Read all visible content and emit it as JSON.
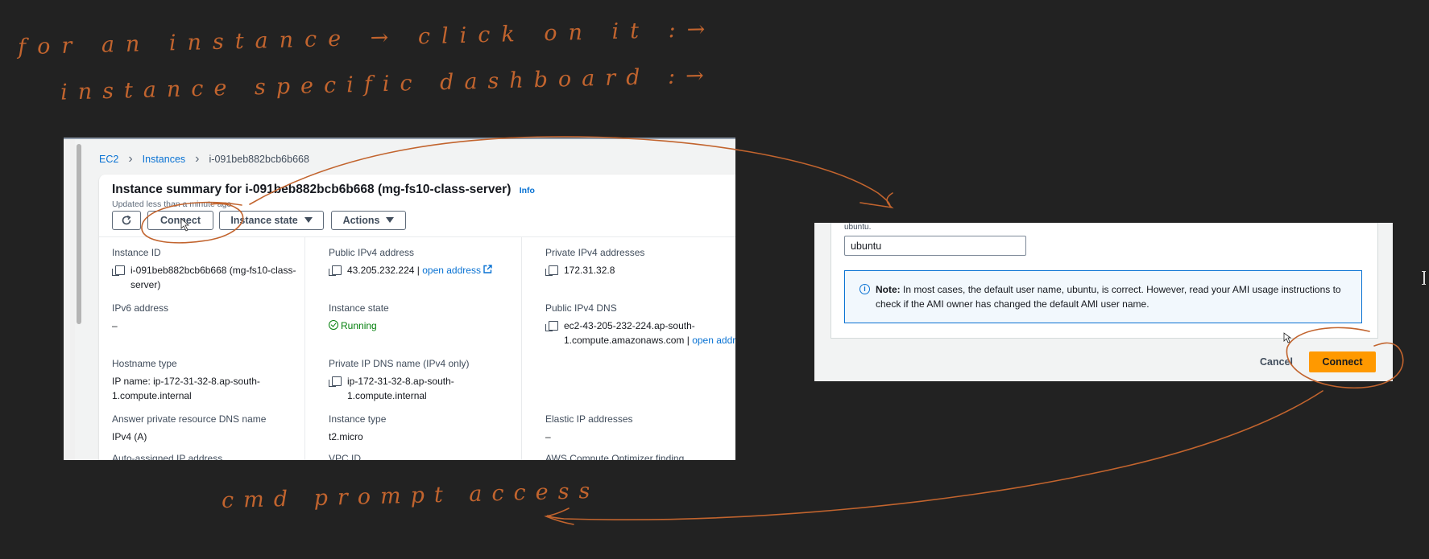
{
  "annotations": {
    "line1": "for an instance → click on it :→",
    "line2": "instance specific dashboard :→",
    "line3": "cmd prompt access"
  },
  "colors": {
    "background": "#222222",
    "ink": "#c2642e",
    "aws_link": "#0972d3",
    "aws_primary_button": "#ff9900",
    "running_green": "#037f0c"
  },
  "breadcrumb": {
    "items": [
      "EC2",
      "Instances",
      "i-091beb882bcb6b668"
    ]
  },
  "summary": {
    "title": "Instance summary for i-091beb882bcb6b668 (mg-fs10-class-server)",
    "info": "Info",
    "updated": "Updated less than a minute ago",
    "buttons": {
      "refresh_icon": "refresh-icon",
      "connect": "Connect",
      "instance_state": "Instance state",
      "actions": "Actions"
    },
    "fields": {
      "instance_id": {
        "label": "Instance ID",
        "value": "i-091beb882bcb6b668 (mg-fs10-class-server)"
      },
      "public_ipv4": {
        "label": "Public IPv4 address",
        "value": "43.205.232.224 |",
        "link": "open address"
      },
      "private_ipv4": {
        "label": "Private IPv4 addresses",
        "value": "172.31.32.8"
      },
      "ipv6": {
        "label": "IPv6 address",
        "value": "–"
      },
      "instance_state": {
        "label": "Instance state",
        "value": "Running"
      },
      "public_dns": {
        "label": "Public IPv4 DNS",
        "value": "ec2-43-205-232-224.ap-south-1.compute.amazonaws.com |",
        "link": "open address"
      },
      "hostname_type": {
        "label": "Hostname type",
        "value": "IP name: ip-172-31-32-8.ap-south-1.compute.internal"
      },
      "private_dns": {
        "label": "Private IP DNS name (IPv4 only)",
        "value": "ip-172-31-32-8.ap-south-1.compute.internal"
      },
      "answer_dns": {
        "label": "Answer private resource DNS name",
        "value": "IPv4 (A)"
      },
      "instance_type": {
        "label": "Instance type",
        "value": "t2.micro"
      },
      "elastic_ip": {
        "label": "Elastic IP addresses",
        "value": "–"
      },
      "auto_assigned": {
        "label": "Auto-assigned IP address"
      },
      "vpc_id": {
        "label": "VPC ID"
      },
      "optimizer": {
        "label": "AWS Compute Optimizer finding"
      }
    }
  },
  "connect_dialog": {
    "username_hint": "ubuntu.",
    "username_value": "ubuntu",
    "note_bold": "Note:",
    "note_text": " In most cases, the default user name, ubuntu, is correct. However, read your AMI usage instructions to check if the AMI owner has changed the default AMI user name.",
    "cancel": "Cancel",
    "connect": "Connect"
  }
}
